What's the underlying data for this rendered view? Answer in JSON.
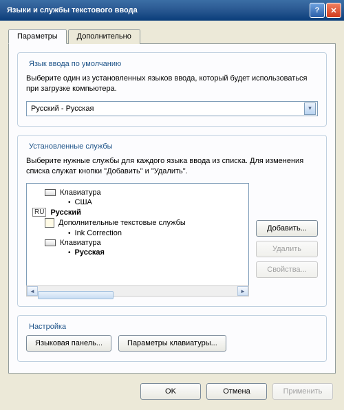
{
  "window": {
    "title": "Языки и службы текстового ввода"
  },
  "tabs": {
    "params": "Параметры",
    "advanced": "Дополнительно"
  },
  "defaultLang": {
    "legend": "Язык ввода по умолчанию",
    "desc": "Выберите один из установленных языков ввода, который будет использоваться при загрузке компьютера.",
    "selected": "Русский - Русская"
  },
  "services": {
    "legend": "Установленные службы",
    "desc": "Выберите нужные службы для каждого языка ввода из списка. Для изменения списка служат кнопки \"Добавить\" и \"Удалить\".",
    "tree": {
      "kbd_en": "Клавиатура",
      "us": "США",
      "ru_badge": "RU",
      "ru_lang": "Русский",
      "addtext": "Дополнительные текстовые службы",
      "ink": "Ink Correction",
      "kbd_ru": "Клавиатура",
      "ru_layout": "Русская"
    },
    "buttons": {
      "add": "Добавить...",
      "remove": "Удалить",
      "props": "Свойства..."
    }
  },
  "settings": {
    "legend": "Настройка",
    "langbar": "Языковая панель...",
    "kbdparams": "Параметры клавиатуры..."
  },
  "footer": {
    "ok": "OK",
    "cancel": "Отмена",
    "apply": "Применить"
  }
}
